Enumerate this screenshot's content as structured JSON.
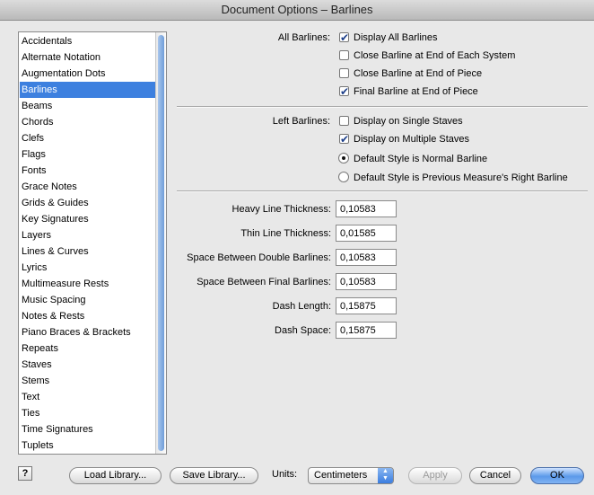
{
  "window": {
    "title": "Document Options – Barlines"
  },
  "sidebar": {
    "items": [
      "Accidentals",
      "Alternate Notation",
      "Augmentation Dots",
      "Barlines",
      "Beams",
      "Chords",
      "Clefs",
      "Flags",
      "Fonts",
      "Grace Notes",
      "Grids & Guides",
      "Key Signatures",
      "Layers",
      "Lines & Curves",
      "Lyrics",
      "Multimeasure Rests",
      "Music Spacing",
      "Notes & Rests",
      "Piano Braces & Brackets",
      "Repeats",
      "Staves",
      "Stems",
      "Text",
      "Ties",
      "Time Signatures",
      "Tuplets"
    ],
    "selected": "Barlines"
  },
  "all_barlines": {
    "label": "All Barlines:",
    "options": [
      {
        "label": "Display All Barlines",
        "checked": true
      },
      {
        "label": "Close Barline at End of Each System",
        "checked": false
      },
      {
        "label": "Close Barline at End of Piece",
        "checked": false
      },
      {
        "label": "Final Barline at End of Piece",
        "checked": true
      }
    ]
  },
  "left_barlines": {
    "label": "Left Barlines:",
    "checkboxes": [
      {
        "label": "Display on Single Staves",
        "checked": false
      },
      {
        "label": "Display on Multiple Staves",
        "checked": true
      }
    ],
    "radios": [
      {
        "label": "Default Style is Normal Barline",
        "selected": true
      },
      {
        "label": "Default Style is Previous Measure's Right Barline",
        "selected": false
      }
    ]
  },
  "fields": [
    {
      "label": "Heavy Line Thickness:",
      "value": "0,10583"
    },
    {
      "label": "Thin Line Thickness:",
      "value": "0,01585"
    },
    {
      "label": "Space Between Double Barlines:",
      "value": "0,10583"
    },
    {
      "label": "Space Between Final Barlines:",
      "value": "0,10583"
    },
    {
      "label": "Dash Length:",
      "value": "0,15875"
    },
    {
      "label": "Dash Space:",
      "value": "0,15875"
    }
  ],
  "footer": {
    "help": "?",
    "load_library": "Load Library...",
    "save_library": "Save Library...",
    "units_label": "Units:",
    "units_value": "Centimeters",
    "apply": "Apply",
    "cancel": "Cancel",
    "ok": "OK"
  }
}
